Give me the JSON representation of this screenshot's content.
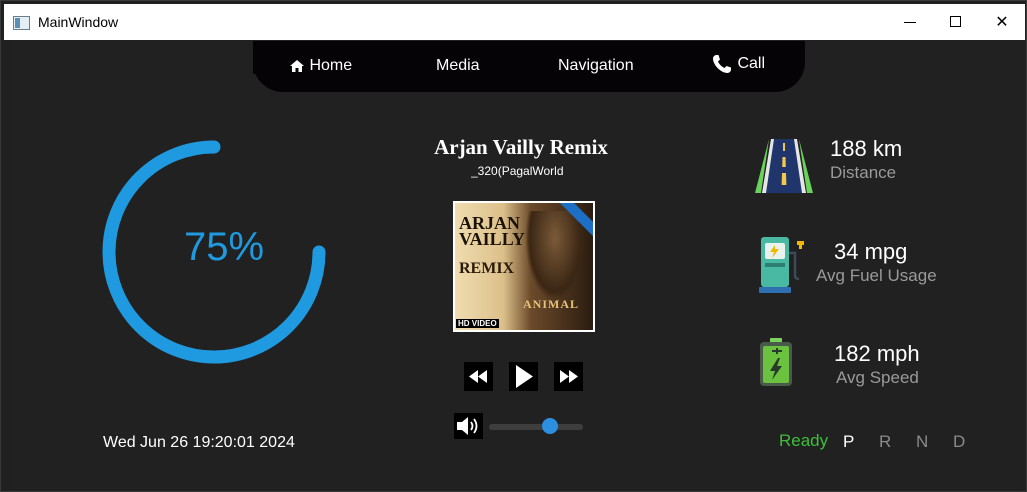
{
  "window": {
    "title": "MainWindow",
    "controls": {
      "minimize": "minimize",
      "maximize": "maximize",
      "close": "✕"
    }
  },
  "nav": {
    "items": [
      {
        "label": "Home",
        "icon": "home-icon"
      },
      {
        "label": "Media"
      },
      {
        "label": "Navigation"
      },
      {
        "label": "Call",
        "icon": "phone-icon"
      }
    ]
  },
  "gauge": {
    "value_text": "75%",
    "value_fraction": 0.75,
    "color": "#1f9ae0"
  },
  "datetime": "Wed Jun 26 19:20:01 2024",
  "media": {
    "title": "Arjan Vailly Remix",
    "subtitle": "_320(PagalWorld",
    "cover": {
      "line1": "ARJAN",
      "line2": "VAILLY",
      "line3": "REMIX",
      "film": "ANIMAL",
      "badge": "HD VIDEO"
    },
    "controls": {
      "rewind": "rewind-icon",
      "play": "play-icon",
      "forward": "fast-forward-icon"
    },
    "volume": {
      "icon": "speaker-icon",
      "level": 0.65,
      "accent": "#2d8fe0"
    }
  },
  "stats": [
    {
      "value": "188 km",
      "label": "Distance",
      "icon": "road-icon"
    },
    {
      "value": "34 mpg",
      "label": "Avg Fuel Usage",
      "icon": "fuel-station-icon"
    },
    {
      "value": "182 mph",
      "label": "Avg Speed",
      "icon": "battery-icon"
    }
  ],
  "gears": {
    "status": "Ready",
    "status_color": "#3dbf3a",
    "items": [
      {
        "label": "P",
        "active": true
      },
      {
        "label": "R",
        "active": false
      },
      {
        "label": "N",
        "active": false
      },
      {
        "label": "D",
        "active": false
      }
    ],
    "active_color": "#ffffff",
    "inactive_color": "#8a8a8a"
  }
}
